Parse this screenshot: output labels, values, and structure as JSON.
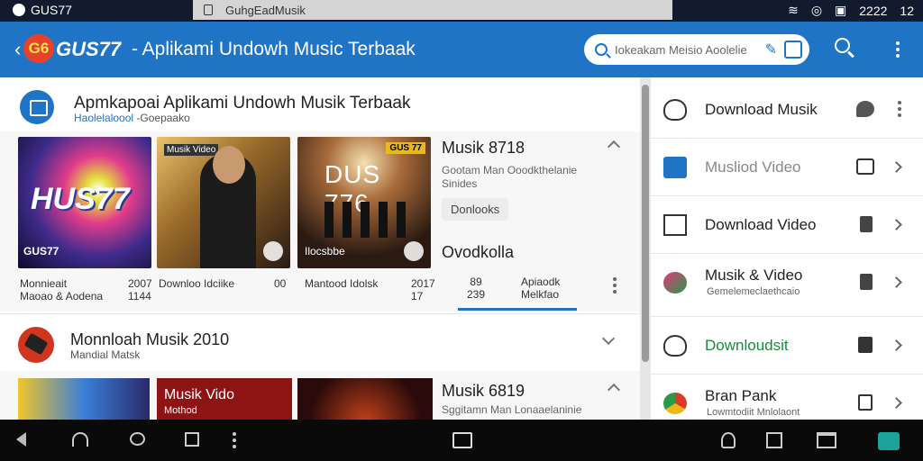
{
  "status_bar": {
    "brand": "GUS77",
    "url": "GuhgEadMusik",
    "time": "2222",
    "battery": "12"
  },
  "app_bar": {
    "logo_text": "G6",
    "brand": "GUS77",
    "title": "- Aplikami Undowh Music Terbaak",
    "search_placeholder": "Iokeakam Meisio Aoolelie"
  },
  "section1": {
    "title": "Apmkapoai Aplikami Undowh Musik Terbaak",
    "subtitle_link": "Haolelaloool",
    "subtitle_rest": "-Goepaako",
    "thumbnails": [
      {
        "overlay": "HUS77",
        "corner": "GUS77",
        "caption": "Monnieait",
        "caption2": "Maoao & Aodena",
        "num1": "2007",
        "num2": "1144"
      },
      {
        "overlay": "Musik Video",
        "caption": "Downloo Idciike",
        "num1": "00",
        "num2": ""
      },
      {
        "overlay": "DUS 776",
        "badge": "GUS 77",
        "label": "Ilocsbbe",
        "caption": "Mantood Idolsk",
        "num1": "2017",
        "num2": "17"
      }
    ],
    "info": {
      "name": "Musik 8718",
      "desc": "Gootam Man Ooodkthelanie Sinides",
      "pill": "Donlooks",
      "download_title": "Ovodkolla",
      "count1": "89",
      "count2": "239",
      "tab_label1": "Apiaodk",
      "tab_label2": "Melkfao"
    }
  },
  "section2": {
    "title": "Monnloah Musik 2010",
    "subtitle": "Mandial Matsk",
    "thumbnails": [
      {
        "overlay": ""
      },
      {
        "overlay": "Musik Vido",
        "sub": "Mothod"
      },
      {
        "overlay": ""
      }
    ],
    "info": {
      "name": "Musik 6819",
      "desc": "Sggitamn Man Lonaaelaninie"
    }
  },
  "side_list": [
    {
      "label": "Download Musik",
      "sub": "",
      "style": "normal"
    },
    {
      "label": "Musliod Video",
      "sub": "",
      "style": "muted"
    },
    {
      "label": "Download Video",
      "sub": "",
      "style": "normal"
    },
    {
      "label": "Musik & Video",
      "sub": "Gemelemeclaethcaio",
      "style": "normal"
    },
    {
      "label": "Downloudsit",
      "sub": "",
      "style": "green"
    },
    {
      "label": "Bran Pank",
      "sub": "Lowmtodiit Mnlolaont",
      "style": "normal"
    }
  ],
  "colors": {
    "app_bar": "#1f74c6",
    "accent": "#1f74c6",
    "green_label": "#1a8a3a",
    "muted_label": "#888888",
    "nav_bar": "#0a0a0a"
  },
  "icons": {
    "nav": [
      "back-icon",
      "headset-icon",
      "chat-icon",
      "square-icon",
      "more-icon",
      "book-icon",
      "user-icon",
      "split-icon",
      "window-icon",
      "app-icon"
    ]
  }
}
